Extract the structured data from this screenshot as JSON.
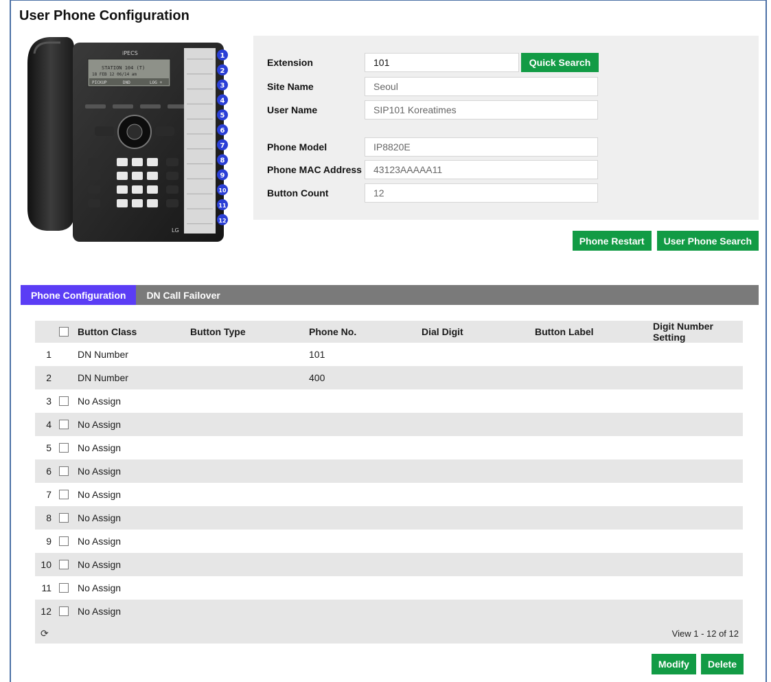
{
  "page_title": "User Phone Configuration",
  "phone_image": {
    "brand": "iPECS",
    "display_line1": "STATION 104  (T)",
    "display_line2": "18 FEB 12      06/14 am",
    "display_softkeys": [
      "PICKUP",
      "DND",
      "LOG +"
    ],
    "button_numbers": [
      "1",
      "2",
      "3",
      "4",
      "5",
      "6",
      "7",
      "8",
      "9",
      "10",
      "11",
      "12"
    ],
    "maker": "LG"
  },
  "info": {
    "extension_label": "Extension",
    "extension_value": "101",
    "quick_search": "Quick Search",
    "site_name_label": "Site Name",
    "site_name_value": "Seoul",
    "user_name_label": "User Name",
    "user_name_value": "SIP101 Koreatimes",
    "phone_model_label": "Phone Model",
    "phone_model_value": "IP8820E",
    "mac_label": "Phone MAC Address",
    "mac_value": "43123AAAAA11",
    "button_count_label": "Button Count",
    "button_count_value": "12"
  },
  "actions": {
    "phone_restart": "Phone Restart",
    "user_phone_search": "User Phone Search"
  },
  "tabs": [
    {
      "label": "Phone Configuration",
      "active": true
    },
    {
      "label": "DN Call Failover",
      "active": false
    }
  ],
  "grid": {
    "columns": [
      "Button Class",
      "Button Type",
      "Phone No.",
      "Dial Digit",
      "Button Label",
      "Digit Number Setting"
    ],
    "rows": [
      {
        "num": "1",
        "checkbox": false,
        "class": "DN Number",
        "type": "",
        "phone": "101",
        "dial": "",
        "label": "",
        "digit": ""
      },
      {
        "num": "2",
        "checkbox": false,
        "class": "DN Number",
        "type": "",
        "phone": "400",
        "dial": "",
        "label": "",
        "digit": ""
      },
      {
        "num": "3",
        "checkbox": true,
        "class": "No Assign",
        "type": "",
        "phone": "",
        "dial": "",
        "label": "",
        "digit": ""
      },
      {
        "num": "4",
        "checkbox": true,
        "class": "No Assign",
        "type": "",
        "phone": "",
        "dial": "",
        "label": "",
        "digit": ""
      },
      {
        "num": "5",
        "checkbox": true,
        "class": "No Assign",
        "type": "",
        "phone": "",
        "dial": "",
        "label": "",
        "digit": ""
      },
      {
        "num": "6",
        "checkbox": true,
        "class": "No Assign",
        "type": "",
        "phone": "",
        "dial": "",
        "label": "",
        "digit": ""
      },
      {
        "num": "7",
        "checkbox": true,
        "class": "No Assign",
        "type": "",
        "phone": "",
        "dial": "",
        "label": "",
        "digit": ""
      },
      {
        "num": "8",
        "checkbox": true,
        "class": "No Assign",
        "type": "",
        "phone": "",
        "dial": "",
        "label": "",
        "digit": ""
      },
      {
        "num": "9",
        "checkbox": true,
        "class": "No Assign",
        "type": "",
        "phone": "",
        "dial": "",
        "label": "",
        "digit": ""
      },
      {
        "num": "10",
        "checkbox": true,
        "class": "No Assign",
        "type": "",
        "phone": "",
        "dial": "",
        "label": "",
        "digit": ""
      },
      {
        "num": "11",
        "checkbox": true,
        "class": "No Assign",
        "type": "",
        "phone": "",
        "dial": "",
        "label": "",
        "digit": ""
      },
      {
        "num": "12",
        "checkbox": true,
        "class": "No Assign",
        "type": "",
        "phone": "",
        "dial": "",
        "label": "",
        "digit": ""
      }
    ],
    "refresh_icon": "refresh-icon",
    "view_text": "View 1 - 12 of 12"
  },
  "bottom_actions": {
    "modify": "Modify",
    "delete": "Delete"
  },
  "colors": {
    "green_button": "#129b45",
    "active_tab": "#5b3df5",
    "tab_bar": "#7a7a7a",
    "panel_bg": "#efefef",
    "row_alt": "#e6e6e6",
    "number_badge": "#2a3fd6"
  }
}
